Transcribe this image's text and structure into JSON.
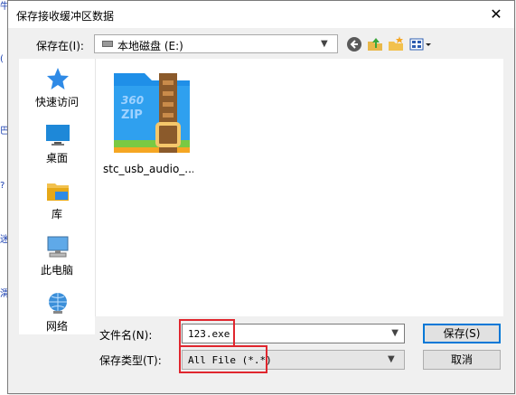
{
  "window": {
    "title": "保存接收缓冲区数据"
  },
  "location": {
    "label": "保存在(I):",
    "value": "本地磁盘 (E:)"
  },
  "toolbar": {
    "back": "back-icon",
    "up": "up-folder-icon",
    "new_folder": "new-folder-icon",
    "view": "view-menu-icon"
  },
  "sidebar": {
    "items": [
      {
        "label": "快速访问",
        "icon": "star-icon"
      },
      {
        "label": "桌面",
        "icon": "desktop-icon"
      },
      {
        "label": "库",
        "icon": "library-icon"
      },
      {
        "label": "此电脑",
        "icon": "computer-icon"
      },
      {
        "label": "网络",
        "icon": "network-icon"
      }
    ]
  },
  "files": [
    {
      "name": "stc_usb_audio_...",
      "icon": "zip-archive-icon",
      "badge": "360",
      "badge2": "ZIP"
    }
  ],
  "filename": {
    "label": "文件名(N):",
    "value": "123.exe"
  },
  "filetype": {
    "label": "保存类型(T):",
    "value": "All File (*.*)"
  },
  "buttons": {
    "save": "保存(S)",
    "cancel": "取消"
  },
  "colors": {
    "highlight": "#e0262e",
    "accent": "#0078d7"
  }
}
